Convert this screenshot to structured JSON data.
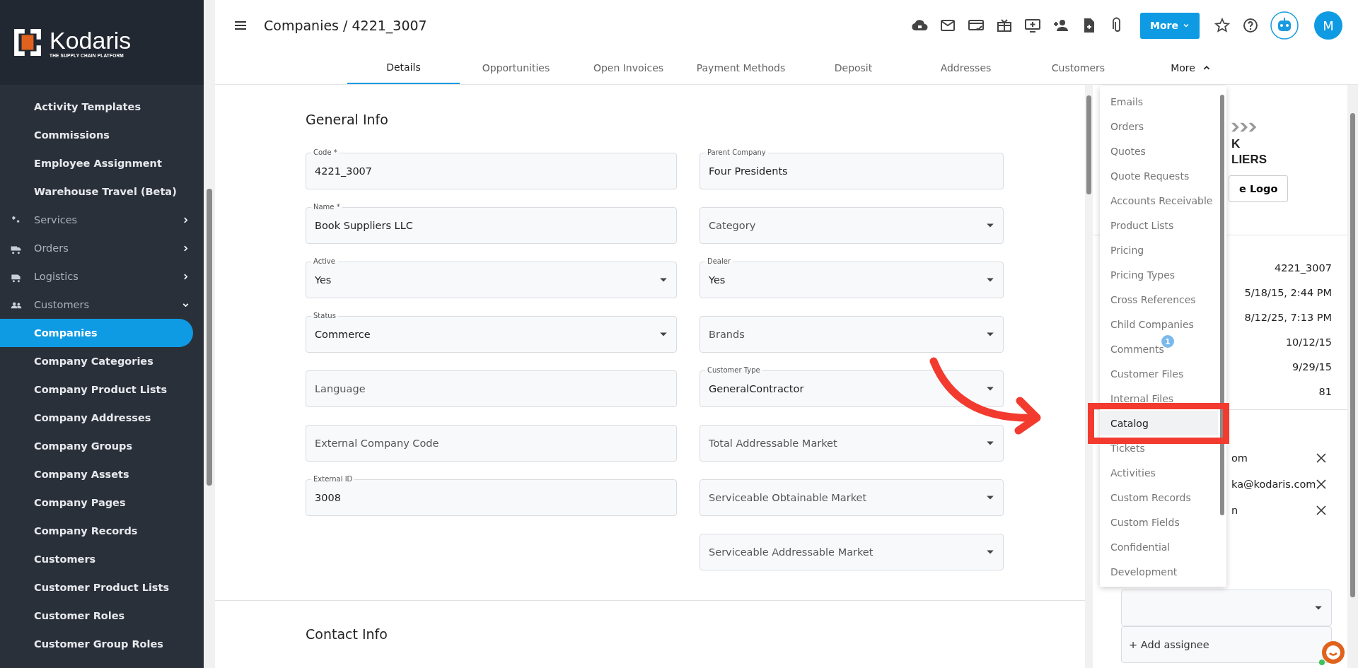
{
  "sidebar": {
    "logo": {
      "name": "Kodaris",
      "tagline": "THE SUPPLY CHAIN PLATFORM"
    },
    "items": [
      {
        "label": "Activity Templates",
        "kind": "sub",
        "selected": false
      },
      {
        "label": "Commissions",
        "kind": "sub",
        "selected": false
      },
      {
        "label": "Employee Assignment",
        "kind": "sub",
        "selected": false
      },
      {
        "label": "Warehouse Travel (Beta)",
        "kind": "sub",
        "selected": false
      },
      {
        "label": "Services",
        "kind": "group",
        "expanded": false
      },
      {
        "label": "Orders",
        "kind": "group",
        "expanded": false
      },
      {
        "label": "Logistics",
        "kind": "group",
        "expanded": false
      },
      {
        "label": "Customers",
        "kind": "group",
        "expanded": true
      },
      {
        "label": "Companies",
        "kind": "sub",
        "selected": true
      },
      {
        "label": "Company Categories",
        "kind": "sub",
        "selected": false
      },
      {
        "label": "Company Product Lists",
        "kind": "sub",
        "selected": false
      },
      {
        "label": "Company Addresses",
        "kind": "sub",
        "selected": false
      },
      {
        "label": "Company Groups",
        "kind": "sub",
        "selected": false
      },
      {
        "label": "Company Assets",
        "kind": "sub",
        "selected": false
      },
      {
        "label": "Company Pages",
        "kind": "sub",
        "selected": false
      },
      {
        "label": "Company Records",
        "kind": "sub",
        "selected": false
      },
      {
        "label": "Customers",
        "kind": "sub",
        "selected": false
      },
      {
        "label": "Customer Product Lists",
        "kind": "sub",
        "selected": false
      },
      {
        "label": "Customer Roles",
        "kind": "sub",
        "selected": false
      },
      {
        "label": "Customer Group Roles",
        "kind": "sub",
        "selected": false
      }
    ]
  },
  "header": {
    "breadcrumb": "Companies / 4221_3007",
    "more_button": "More",
    "avatar": "M"
  },
  "tabs": [
    {
      "label": "Details",
      "selected": true
    },
    {
      "label": "Opportunities",
      "selected": false
    },
    {
      "label": "Open Invoices",
      "selected": false
    },
    {
      "label": "Payment Methods",
      "selected": false
    },
    {
      "label": "Deposit",
      "selected": false
    },
    {
      "label": "Addresses",
      "selected": false
    },
    {
      "label": "Customers",
      "selected": false
    },
    {
      "label": "More",
      "selected": false,
      "kind": "menu",
      "expanded": true
    }
  ],
  "general_info": {
    "title": "General Info",
    "left": [
      {
        "kind": "text",
        "label": "Code *",
        "value": "4221_3007"
      },
      {
        "kind": "text",
        "label": "Name *",
        "value": "Book Suppliers LLC"
      },
      {
        "kind": "select",
        "label": "Active",
        "value": "Yes"
      },
      {
        "kind": "select",
        "label": "Status",
        "value": "Commerce"
      },
      {
        "kind": "text",
        "placeholder": "Language"
      },
      {
        "kind": "text",
        "placeholder": "External Company Code"
      },
      {
        "kind": "text",
        "label": "External ID",
        "value": "3008"
      }
    ],
    "right": [
      {
        "kind": "text",
        "label": "Parent Company",
        "value": "Four Presidents"
      },
      {
        "kind": "select",
        "placeholder": "Category"
      },
      {
        "kind": "select",
        "label": "Dealer",
        "value": "Yes"
      },
      {
        "kind": "select",
        "placeholder": "Brands"
      },
      {
        "kind": "select",
        "label": "Customer Type",
        "value": "GeneralContractor"
      },
      {
        "kind": "select",
        "placeholder": "Total Addressable Market"
      },
      {
        "kind": "select",
        "placeholder": "Serviceable Obtainable Market"
      },
      {
        "kind": "select",
        "placeholder": "Serviceable Addressable Market"
      }
    ]
  },
  "contact_info": {
    "title": "Contact Info"
  },
  "more_menu": {
    "items": [
      {
        "label": "Emails",
        "selected": false
      },
      {
        "label": "Orders",
        "selected": false
      },
      {
        "label": "Quotes",
        "selected": false
      },
      {
        "label": "Quote Requests",
        "selected": false
      },
      {
        "label": "Accounts Receivable",
        "selected": false
      },
      {
        "label": "Product Lists",
        "selected": false
      },
      {
        "label": "Pricing",
        "selected": false
      },
      {
        "label": "Pricing Types",
        "selected": false
      },
      {
        "label": "Cross References",
        "selected": false
      },
      {
        "label": "Child Companies",
        "selected": false
      },
      {
        "label": "Comments",
        "selected": false,
        "badge": "1"
      },
      {
        "label": "Customer Files",
        "selected": false
      },
      {
        "label": "Internal Files",
        "selected": false
      },
      {
        "label": "Catalog",
        "selected": true
      },
      {
        "label": "Tickets",
        "selected": false
      },
      {
        "label": "Activities",
        "selected": false
      },
      {
        "label": "Custom Records",
        "selected": false
      },
      {
        "label": "Custom Fields",
        "selected": false
      },
      {
        "label": "Confidential",
        "selected": false
      },
      {
        "label": "Development",
        "selected": false
      }
    ]
  },
  "right_panel": {
    "logo_lines": [
      "K",
      "LIERS"
    ],
    "logo_button": "e Logo",
    "details": [
      "4221_3007",
      "5/18/15, 2:44 PM",
      "8/12/25, 7:13 PM",
      "10/12/15",
      "9/29/15",
      "81"
    ],
    "assignees": [
      "om",
      "ka@kodaris.com",
      "n"
    ],
    "add_assignee": "+ Add assignee"
  }
}
